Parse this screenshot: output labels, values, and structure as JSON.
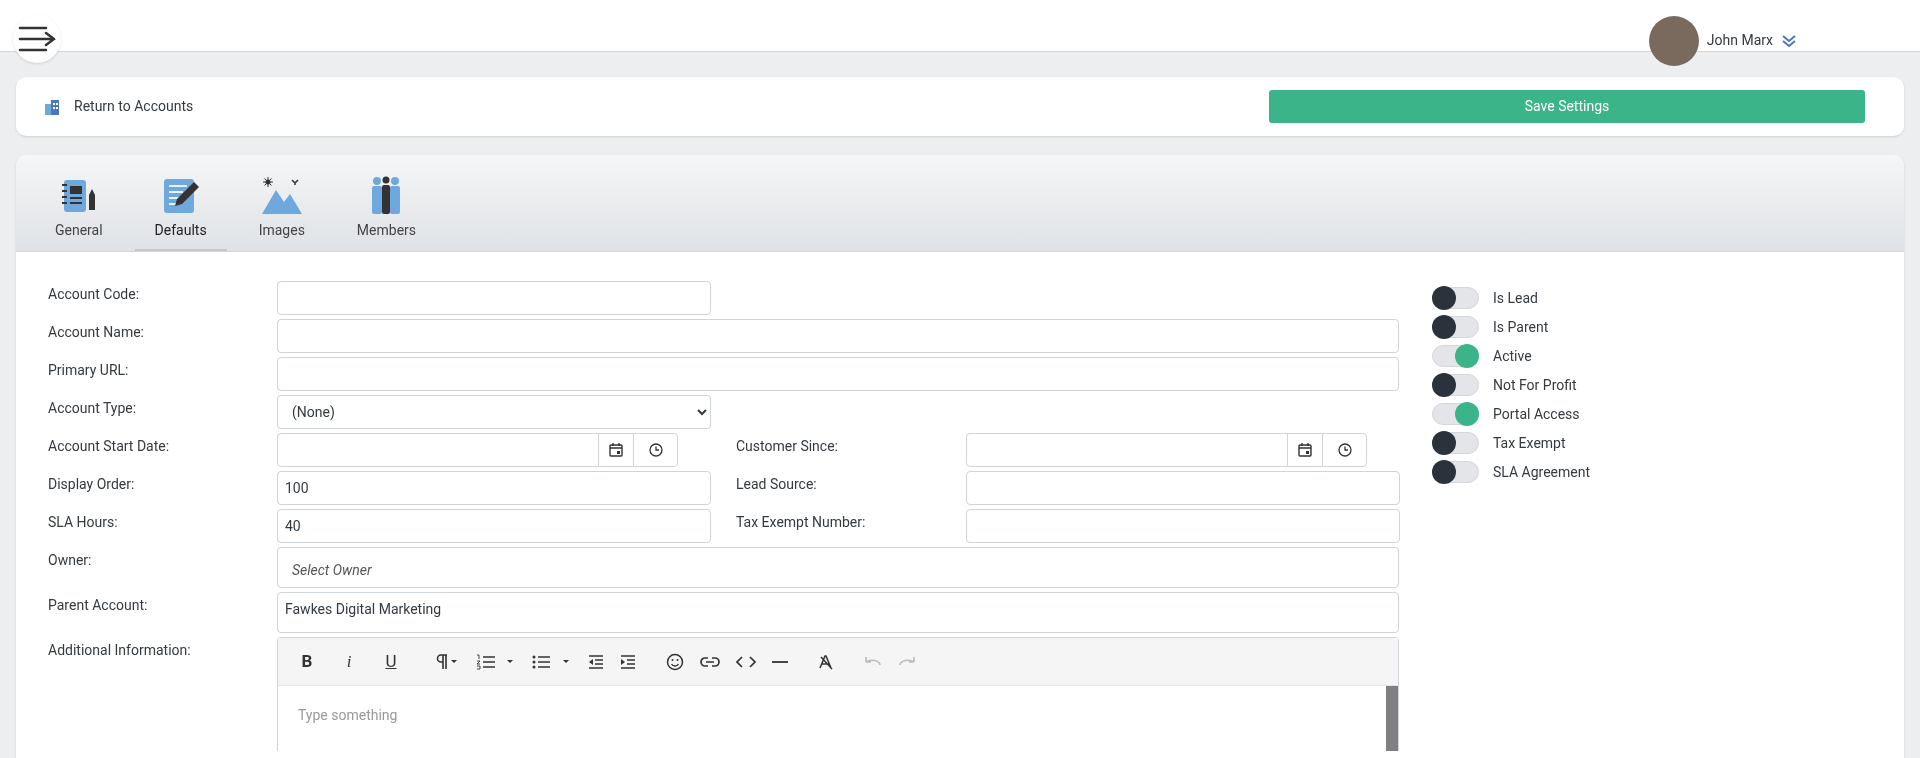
{
  "header": {
    "user": {
      "name": "John Marx"
    }
  },
  "top_bar": {
    "back_link": "Return to Accounts",
    "save_button": "Save Settings"
  },
  "tabs": [
    {
      "label": "General",
      "kind": "notebook",
      "selected": false
    },
    {
      "label": "Defaults",
      "kind": "edit",
      "selected": true
    },
    {
      "label": "Images",
      "kind": "landscape",
      "selected": false
    },
    {
      "label": "Members",
      "kind": "people",
      "selected": false
    }
  ],
  "form": {
    "rows": [
      [
        {
          "label": "Account Code:",
          "kind": "text",
          "wide": false
        }
      ],
      [
        {
          "label": "Account Name:",
          "kind": "text",
          "wide": true
        }
      ],
      [
        {
          "label": "Primary URL:",
          "kind": "text",
          "wide": true
        }
      ],
      [
        {
          "label": "Account Type:",
          "kind": "select",
          "value": "(None)",
          "wide": false
        }
      ],
      [
        {
          "label": "Account Start Date:",
          "kind": "datetime"
        },
        {
          "label": "Customer Since:",
          "kind": "datetime"
        }
      ],
      [
        {
          "label": "Display Order:",
          "kind": "text",
          "value": "100",
          "wide": false
        },
        {
          "label": "Lead Source:",
          "kind": "text",
          "wide": false
        }
      ],
      [
        {
          "label": "SLA Hours:",
          "kind": "text",
          "value": "40",
          "wide": false
        },
        {
          "label": "Tax Exempt Number:",
          "kind": "text",
          "wide": false
        }
      ],
      [
        {
          "label": "Owner:",
          "kind": "lookup",
          "placeholder": "Select Owner",
          "wide": true
        }
      ],
      [
        {
          "label": "Parent Account:",
          "kind": "lookup",
          "value": "Fawkes Digital Marketing",
          "wide": true
        }
      ]
    ],
    "editor": {
      "label": "Additional Information:",
      "placeholder": "Type something",
      "toolbar": [
        [
          {
            "kind": "bold",
            "label": "B",
            "disabled": false
          },
          {
            "kind": "italic",
            "label": "i",
            "disabled": false
          },
          {
            "kind": "underline",
            "label": "U",
            "disabled": false
          }
        ],
        [
          {
            "kind": "paragraph",
            "disabled": false
          },
          {
            "kind": "ordered-list",
            "disabled": false
          },
          {
            "kind": "bullet-list",
            "disabled": false
          },
          {
            "kind": "outdent",
            "disabled": false
          },
          {
            "kind": "indent",
            "disabled": false
          }
        ],
        [
          {
            "kind": "emoji",
            "disabled": false
          },
          {
            "kind": "link",
            "disabled": false
          },
          {
            "kind": "code",
            "disabled": false
          },
          {
            "kind": "rule",
            "disabled": false
          }
        ],
        [
          {
            "kind": "clear-format",
            "disabled": false
          }
        ],
        [
          {
            "kind": "undo",
            "disabled": true
          },
          {
            "kind": "redo",
            "disabled": true
          }
        ]
      ]
    }
  },
  "toggles": [
    {
      "label": "Is Lead",
      "on": false
    },
    {
      "label": "Is Parent",
      "on": false
    },
    {
      "label": "Active",
      "on": true
    },
    {
      "label": "Not For Profit",
      "on": false
    },
    {
      "label": "Portal Access",
      "on": true
    },
    {
      "label": "Tax Exempt",
      "on": false
    },
    {
      "label": "SLA Agreement",
      "on": false
    }
  ]
}
